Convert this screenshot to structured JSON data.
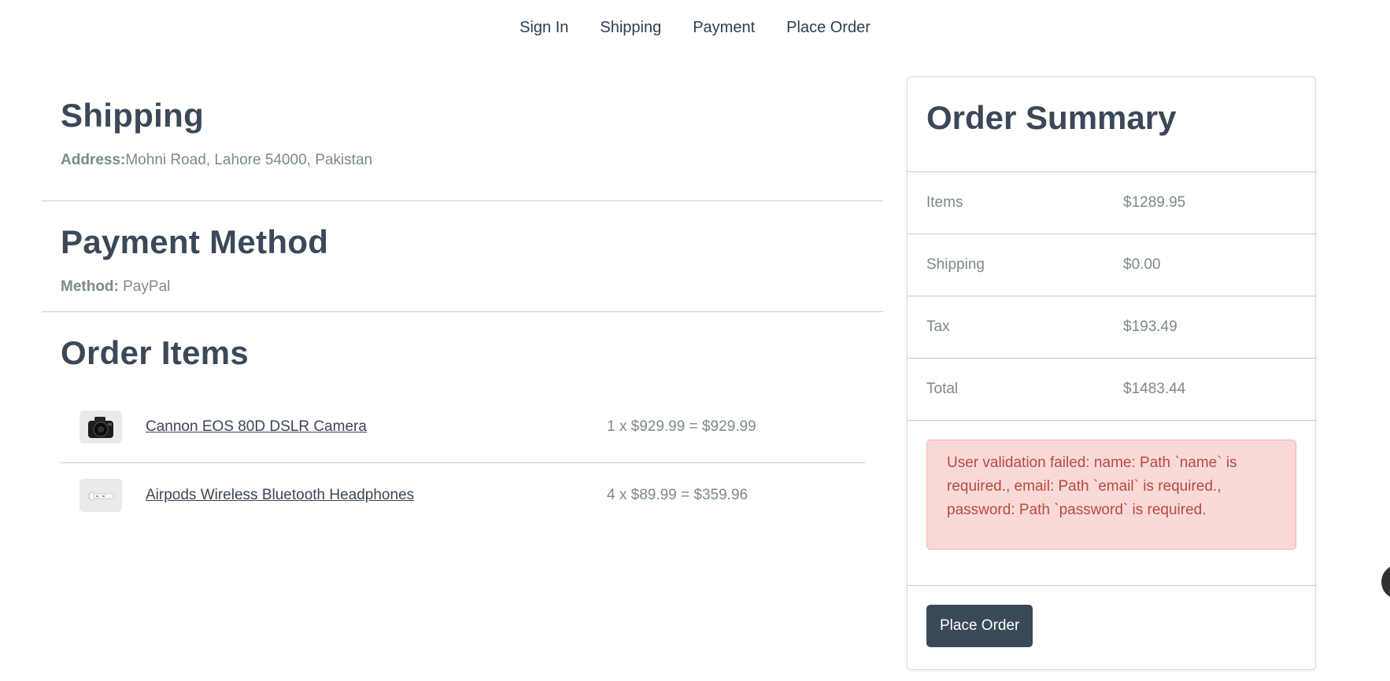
{
  "steps": [
    "Sign In",
    "Shipping",
    "Payment",
    "Place Order"
  ],
  "shipping": {
    "title": "Shipping",
    "address_label": "Address:",
    "address_value": "Mohni Road, Lahore 54000, Pakistan"
  },
  "payment": {
    "title": "Payment Method",
    "method_label": "Method:",
    "method_value": "PayPal"
  },
  "order_items": {
    "title": "Order Items",
    "items": [
      {
        "name": "Cannon EOS 80D DSLR Camera",
        "price": "1 x $929.99 = $929.99",
        "image": "camera-icon"
      },
      {
        "name": "Airpods Wireless Bluetooth Headphones",
        "price": "4 x $89.99 = $359.96",
        "image": "airpods-icon"
      }
    ]
  },
  "summary": {
    "title": "Order Summary",
    "rows": [
      {
        "label": "Items",
        "value": "$1289.95"
      },
      {
        "label": "Shipping",
        "value": "$0.00"
      },
      {
        "label": "Tax",
        "value": "$193.49"
      },
      {
        "label": "Total",
        "value": "$1483.44"
      }
    ],
    "error": "User validation failed: name: Path `name` is required., email: Path `email` is required., password: Path `password` is required.",
    "button": "Place Order"
  },
  "colors": {
    "primary": "#3b4858",
    "muted_text": "#7b8a8b",
    "alert_bg": "#f9d9d8",
    "alert_text": "#b84a3f"
  }
}
